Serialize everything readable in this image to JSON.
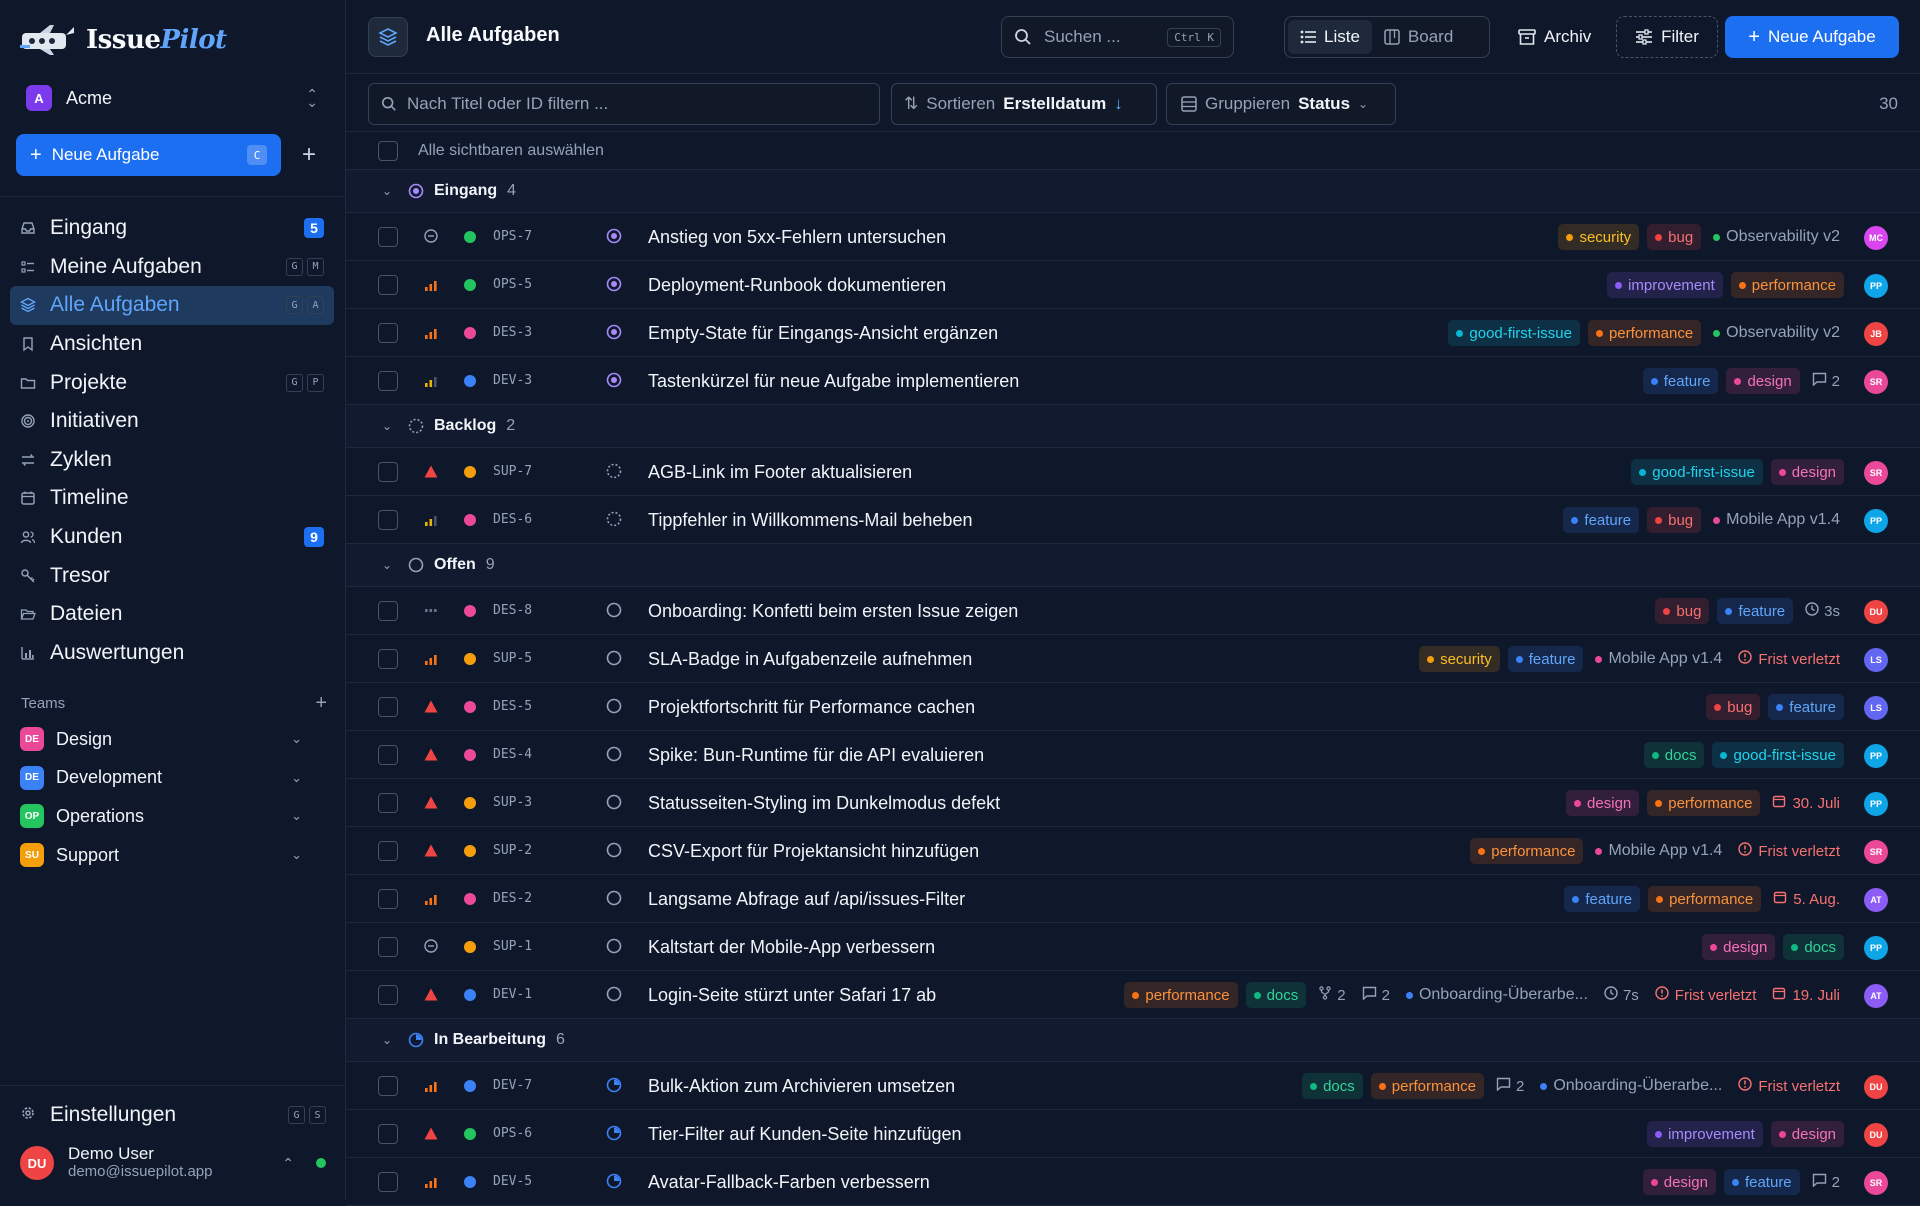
{
  "brand": {
    "part1": "Issue",
    "part2": "Pilot"
  },
  "workspace": {
    "initial": "A",
    "name": "Acme"
  },
  "sidebar": {
    "new_task_label": "Neue Aufgabe",
    "new_task_kbd": "C",
    "nav": [
      {
        "label": "Eingang",
        "icon": "inbox-icon",
        "badge": "5",
        "shortcut": []
      },
      {
        "label": "Meine Aufgaben",
        "icon": "list-icon",
        "badge": "",
        "shortcut": [
          "G",
          "M"
        ]
      },
      {
        "label": "Alle Aufgaben",
        "icon": "layers-icon",
        "badge": "",
        "shortcut": [
          "G",
          "A"
        ],
        "active": true
      },
      {
        "label": "Ansichten",
        "icon": "bookmark-icon",
        "badge": "",
        "shortcut": []
      },
      {
        "label": "Projekte",
        "icon": "folder-icon",
        "badge": "",
        "shortcut": [
          "G",
          "P"
        ]
      },
      {
        "label": "Initiativen",
        "icon": "target-icon",
        "badge": "",
        "shortcut": []
      },
      {
        "label": "Zyklen",
        "icon": "cycle-icon",
        "badge": "",
        "shortcut": []
      },
      {
        "label": "Timeline",
        "icon": "calendar-icon",
        "badge": "",
        "shortcut": []
      },
      {
        "label": "Kunden",
        "icon": "users-icon",
        "badge": "9",
        "shortcut": []
      },
      {
        "label": "Tresor",
        "icon": "key-icon",
        "badge": "",
        "shortcut": []
      },
      {
        "label": "Dateien",
        "icon": "folder-open-icon",
        "badge": "",
        "shortcut": []
      },
      {
        "label": "Auswertungen",
        "icon": "chart-icon",
        "badge": "",
        "shortcut": []
      }
    ],
    "teams_label": "Teams",
    "teams": [
      {
        "initials": "DE",
        "name": "Design",
        "color": "#ec4899"
      },
      {
        "initials": "DE",
        "name": "Development",
        "color": "#3b82f6"
      },
      {
        "initials": "OP",
        "name": "Operations",
        "color": "#22c55e"
      },
      {
        "initials": "SU",
        "name": "Support",
        "color": "#f59e0b"
      }
    ],
    "settings_label": "Einstellungen",
    "settings_shortcut": [
      "G",
      "S"
    ],
    "user": {
      "initials": "DU",
      "name": "Demo User",
      "email": "demo@issuepilot.app"
    }
  },
  "header": {
    "title": "Alle Aufgaben",
    "search_placeholder": "Suchen ...",
    "search_kbd": "Ctrl K",
    "view_list": "Liste",
    "view_board": "Board",
    "archive": "Archiv",
    "filter": "Filter",
    "new_task": "Neue Aufgabe"
  },
  "toolbar": {
    "title_filter_placeholder": "Nach Titel oder ID filtern ...",
    "sort_label": "Sortieren",
    "sort_value": "Erstelldatum",
    "group_label": "Gruppieren",
    "group_value": "Status",
    "total": "30",
    "select_all": "Alle sichtbaren auswählen"
  },
  "colors": {
    "security": "#f59e0b",
    "bug": "#ef4444",
    "improvement": "#8b5cf6",
    "performance": "#f97316",
    "good-first-issue": "#06b6d4",
    "feature": "#3b82f6",
    "design": "#ec4899",
    "docs": "#10b981"
  },
  "groups": [
    {
      "name": "Eingang",
      "count": "4",
      "status": "triage",
      "rows": [
        {
          "prio": "none",
          "team": "#22c55e",
          "id": "OPS-7",
          "title": "Anstieg von 5xx-Fehlern untersuchen",
          "meta": [
            {
              "t": "chip",
              "v": "security"
            },
            {
              "t": "chip",
              "v": "bug"
            },
            {
              "t": "plain",
              "v": "Observability v2",
              "c": "#22c55e"
            }
          ],
          "av": "MC",
          "avc": "#d946ef"
        },
        {
          "prio": "high",
          "team": "#22c55e",
          "id": "OPS-5",
          "title": "Deployment-Runbook dokumentieren",
          "meta": [
            {
              "t": "chip",
              "v": "improvement"
            },
            {
              "t": "chip",
              "v": "performance"
            }
          ],
          "av": "PP",
          "avc": "#0ea5e9"
        },
        {
          "prio": "high",
          "team": "#ec4899",
          "id": "DES-3",
          "title": "Empty-State für Eingangs-Ansicht ergänzen",
          "meta": [
            {
              "t": "chip",
              "v": "good-first-issue"
            },
            {
              "t": "chip",
              "v": "performance"
            },
            {
              "t": "plain",
              "v": "Observability v2",
              "c": "#22c55e"
            }
          ],
          "av": "JB",
          "avc": "#ef4444"
        },
        {
          "prio": "medium",
          "team": "#3b82f6",
          "id": "DEV-3",
          "title": "Tastenkürzel für neue Aufgabe implementieren",
          "meta": [
            {
              "t": "chip",
              "v": "feature"
            },
            {
              "t": "chip",
              "v": "design"
            },
            {
              "t": "comments",
              "v": "2"
            }
          ],
          "av": "SR",
          "avc": "#ec4899"
        }
      ]
    },
    {
      "name": "Backlog",
      "count": "2",
      "status": "backlog",
      "rows": [
        {
          "prio": "urgent",
          "team": "#f59e0b",
          "id": "SUP-7",
          "title": "AGB-Link im Footer aktualisieren",
          "meta": [
            {
              "t": "chip",
              "v": "good-first-issue"
            },
            {
              "t": "chip",
              "v": "design"
            }
          ],
          "av": "SR",
          "avc": "#ec4899"
        },
        {
          "prio": "medium",
          "team": "#ec4899",
          "id": "DES-6",
          "title": "Tippfehler in Willkommens-Mail beheben",
          "meta": [
            {
              "t": "chip",
              "v": "feature"
            },
            {
              "t": "chip",
              "v": "bug"
            },
            {
              "t": "plain",
              "v": "Mobile App v1.4",
              "c": "#ec4899"
            }
          ],
          "av": "PP",
          "avc": "#0ea5e9"
        }
      ]
    },
    {
      "name": "Offen",
      "count": "9",
      "status": "open",
      "rows": [
        {
          "prio": "low",
          "team": "#ec4899",
          "id": "DES-8",
          "title": "Onboarding: Konfetti beim ersten Issue zeigen",
          "meta": [
            {
              "t": "chip",
              "v": "bug"
            },
            {
              "t": "chip",
              "v": "feature"
            },
            {
              "t": "time",
              "v": "3s"
            }
          ],
          "av": "DU",
          "avc": "#ef4444"
        },
        {
          "prio": "high",
          "team": "#f59e0b",
          "id": "SUP-5",
          "title": "SLA-Badge in Aufgabenzeile aufnehmen",
          "meta": [
            {
              "t": "chip",
              "v": "security"
            },
            {
              "t": "chip",
              "v": "feature"
            },
            {
              "t": "plain",
              "v": "Mobile App v1.4",
              "c": "#ec4899"
            },
            {
              "t": "warn",
              "v": "Frist verletzt"
            }
          ],
          "av": "LS",
          "avc": "#6366f1"
        },
        {
          "prio": "urgent",
          "team": "#ec4899",
          "id": "DES-5",
          "title": "Projektfortschritt für Performance cachen",
          "meta": [
            {
              "t": "chip",
              "v": "bug"
            },
            {
              "t": "chip",
              "v": "feature"
            }
          ],
          "av": "LS",
          "avc": "#6366f1"
        },
        {
          "prio": "urgent",
          "team": "#ec4899",
          "id": "DES-4",
          "title": "Spike: Bun-Runtime für die API evaluieren",
          "meta": [
            {
              "t": "chip",
              "v": "docs"
            },
            {
              "t": "chip",
              "v": "good-first-issue"
            }
          ],
          "av": "PP",
          "avc": "#0ea5e9"
        },
        {
          "prio": "urgent",
          "team": "#f59e0b",
          "id": "SUP-3",
          "title": "Statusseiten-Styling im Dunkelmodus defekt",
          "meta": [
            {
              "t": "chip",
              "v": "design"
            },
            {
              "t": "chip",
              "v": "performance"
            },
            {
              "t": "date",
              "v": "30. Juli"
            }
          ],
          "av": "PP",
          "avc": "#0ea5e9"
        },
        {
          "prio": "urgent",
          "team": "#f59e0b",
          "id": "SUP-2",
          "title": "CSV-Export für Projektansicht hinzufügen",
          "meta": [
            {
              "t": "chip",
              "v": "performance"
            },
            {
              "t": "plain",
              "v": "Mobile App v1.4",
              "c": "#ec4899"
            },
            {
              "t": "warn",
              "v": "Frist verletzt"
            }
          ],
          "av": "SR",
          "avc": "#ec4899"
        },
        {
          "prio": "high",
          "team": "#ec4899",
          "id": "DES-2",
          "title": "Langsame Abfrage auf /api/issues-Filter",
          "meta": [
            {
              "t": "chip",
              "v": "feature"
            },
            {
              "t": "chip",
              "v": "performance"
            },
            {
              "t": "date",
              "v": "5. Aug."
            }
          ],
          "av": "AT",
          "avc": "#8b5cf6"
        },
        {
          "prio": "none",
          "team": "#f59e0b",
          "id": "SUP-1",
          "title": "Kaltstart der Mobile-App verbessern",
          "meta": [
            {
              "t": "chip",
              "v": "design"
            },
            {
              "t": "chip",
              "v": "docs"
            }
          ],
          "av": "PP",
          "avc": "#0ea5e9"
        },
        {
          "prio": "urgent",
          "team": "#3b82f6",
          "id": "DEV-1",
          "title": "Login-Seite stürzt unter Safari 17 ab",
          "meta": [
            {
              "t": "chip",
              "v": "performance"
            },
            {
              "t": "chip",
              "v": "docs"
            },
            {
              "t": "branch",
              "v": "2"
            },
            {
              "t": "comments",
              "v": "2"
            },
            {
              "t": "plain",
              "v": "Onboarding-Überarbe...",
              "c": "#3b82f6"
            },
            {
              "t": "time",
              "v": "7s"
            },
            {
              "t": "warn",
              "v": "Frist verletzt"
            },
            {
              "t": "date",
              "v": "19. Juli"
            }
          ],
          "av": "AT",
          "avc": "#8b5cf6"
        }
      ]
    },
    {
      "name": "In Bearbeitung",
      "count": "6",
      "status": "progress",
      "rows": [
        {
          "prio": "high",
          "team": "#3b82f6",
          "id": "DEV-7",
          "title": "Bulk-Aktion zum Archivieren umsetzen",
          "meta": [
            {
              "t": "chip",
              "v": "docs"
            },
            {
              "t": "chip",
              "v": "performance"
            },
            {
              "t": "comments",
              "v": "2"
            },
            {
              "t": "plain",
              "v": "Onboarding-Überarbe...",
              "c": "#3b82f6"
            },
            {
              "t": "warn",
              "v": "Frist verletzt"
            }
          ],
          "av": "DU",
          "avc": "#ef4444"
        },
        {
          "prio": "urgent",
          "team": "#22c55e",
          "id": "OPS-6",
          "title": "Tier-Filter auf Kunden-Seite hinzufügen",
          "meta": [
            {
              "t": "chip",
              "v": "improvement"
            },
            {
              "t": "chip",
              "v": "design"
            }
          ],
          "av": "DU",
          "avc": "#ef4444"
        },
        {
          "prio": "high",
          "team": "#3b82f6",
          "id": "DEV-5",
          "title": "Avatar-Fallback-Farben verbessern",
          "meta": [
            {
              "t": "chip",
              "v": "design"
            },
            {
              "t": "chip",
              "v": "feature"
            },
            {
              "t": "comments",
              "v": "2"
            }
          ],
          "av": "SR",
          "avc": "#ec4899"
        }
      ]
    }
  ]
}
